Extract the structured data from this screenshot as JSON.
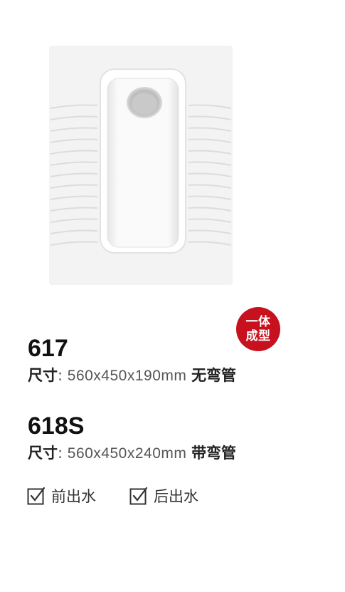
{
  "badge": {
    "line1": "一体",
    "line2": "成型",
    "color": "#c8111f"
  },
  "products": [
    {
      "model": "617",
      "size_label": "尺寸",
      "size_colon": ":",
      "size_value": "560x450x190mm",
      "pipe": "无弯管"
    },
    {
      "model": "618S",
      "size_label": "尺寸",
      "size_colon": ":",
      "size_value": "560x450x240mm",
      "pipe": "带弯管"
    }
  ],
  "options": [
    {
      "label": "前出水",
      "checked": true,
      "icon": "checkbox-checked-icon"
    },
    {
      "label": "后出水",
      "checked": true,
      "icon": "checkbox-checked-icon"
    }
  ]
}
